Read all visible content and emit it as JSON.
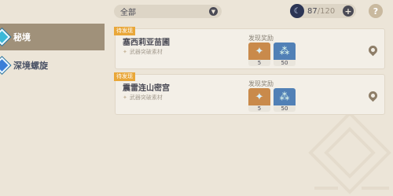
{
  "sidebar": {
    "items": [
      {
        "label": "秘境",
        "icon": "domain-diamond-icon",
        "active": true
      },
      {
        "label": "深境螺旋",
        "icon": "spiral-abyss-diamond-icon",
        "active": false
      }
    ]
  },
  "header": {
    "filter_value": "全部",
    "resin": {
      "current": "87",
      "max": "/120"
    },
    "plus_label": "+",
    "help_label": "?"
  },
  "cards": [
    {
      "badge": "待发现",
      "title": "塞西莉亚苗圃",
      "subtitle": "武器突破素材",
      "reward_label": "发现奖励",
      "rewards": [
        {
          "icon": "primogem-icon",
          "count": "5"
        },
        {
          "icon": "adventure-exp-icon",
          "count": "50"
        }
      ]
    },
    {
      "badge": "待发现",
      "title": "震雷连山密宫",
      "subtitle": "武器突破素材",
      "reward_label": "发现奖励",
      "rewards": [
        {
          "icon": "primogem-icon",
          "count": "5"
        },
        {
          "icon": "adventure-exp-icon",
          "count": "50"
        }
      ]
    }
  ],
  "colors": {
    "background": "#ece5d8",
    "active_tab": "#a0917a",
    "badge": "#e9a739"
  }
}
